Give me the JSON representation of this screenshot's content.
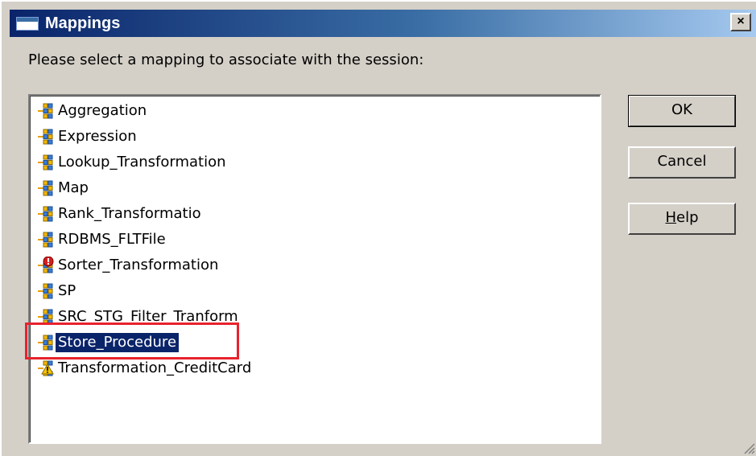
{
  "window": {
    "title": "Mappings",
    "close_glyph": "×"
  },
  "prompt": "Please select a mapping to associate with the session:",
  "mappings": [
    {
      "label": "Aggregation",
      "icon": "mapping-icon"
    },
    {
      "label": "Expression",
      "icon": "mapping-icon"
    },
    {
      "label": "Lookup_Transformation",
      "icon": "mapping-icon"
    },
    {
      "label": "Map",
      "icon": "mapping-icon"
    },
    {
      "label": "Rank_Transformatio",
      "icon": "mapping-icon"
    },
    {
      "label": "RDBMS_FLTFile",
      "icon": "mapping-icon"
    },
    {
      "label": "Sorter_Transformation",
      "icon": "mapping-invalid-icon"
    },
    {
      "label": "SP",
      "icon": "mapping-icon"
    },
    {
      "label": "SRC_STG_Filter_Tranform",
      "icon": "mapping-icon"
    },
    {
      "label": "Store_Procedure",
      "icon": "mapping-icon",
      "selected": true
    },
    {
      "label": "Transformation_CreditCard",
      "icon": "mapping-warning-icon"
    }
  ],
  "buttons": {
    "ok": "OK",
    "cancel": "Cancel",
    "help_accel": "H",
    "help_rest": "elp"
  },
  "colors": {
    "selection": "#0a246a",
    "highlight_box": "#e8222d",
    "dialog_face": "#d4d0c8"
  }
}
